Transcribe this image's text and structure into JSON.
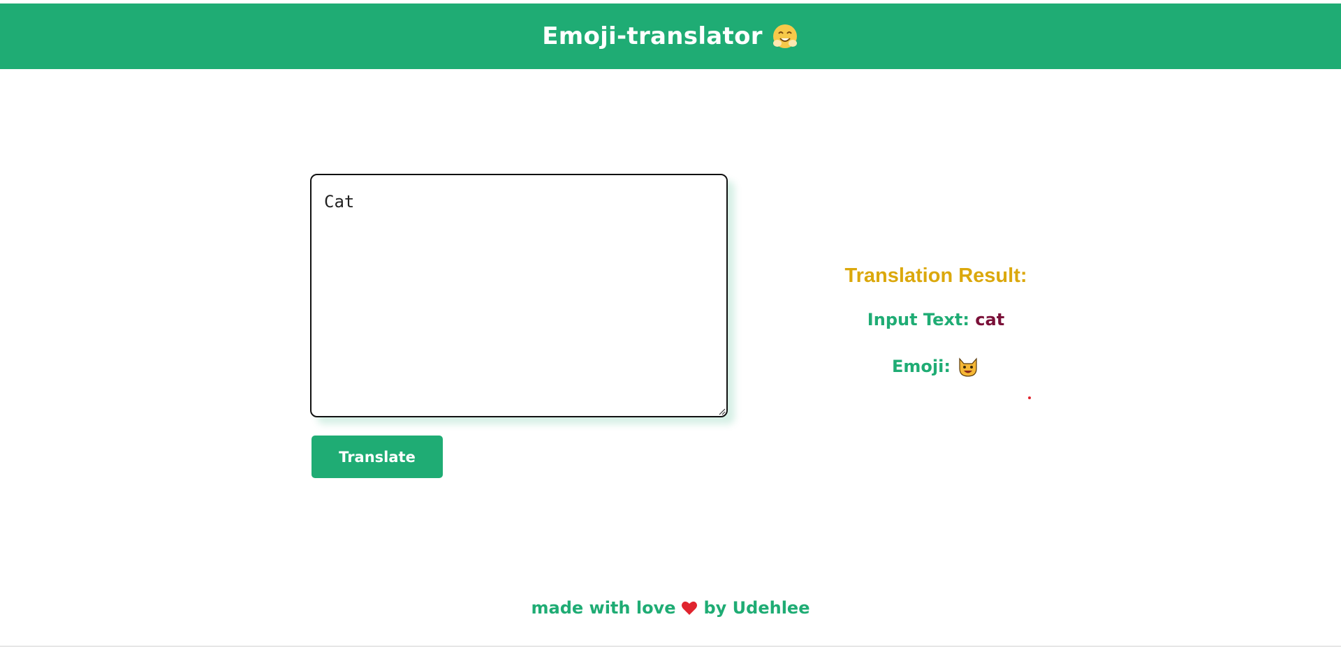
{
  "header": {
    "title": "Emoji-translator",
    "emoji_icon": "hugging-face-icon",
    "bg_color": "#1fac74"
  },
  "input": {
    "value": "Cat",
    "placeholder": ""
  },
  "translate_button": {
    "label": "Translate"
  },
  "result": {
    "heading": "Translation Result:",
    "input_text_label": "Input Text:",
    "input_text_value": "cat",
    "emoji_label": "Emoji:",
    "emoji_icon": "cat-face-icon",
    "heading_color": "#dba80c",
    "label_color": "#1fac74",
    "value_color": "#7a1038"
  },
  "footer": {
    "prefix": "made with love",
    "heart_icon": "heart-icon",
    "suffix": "by Udehlee"
  }
}
